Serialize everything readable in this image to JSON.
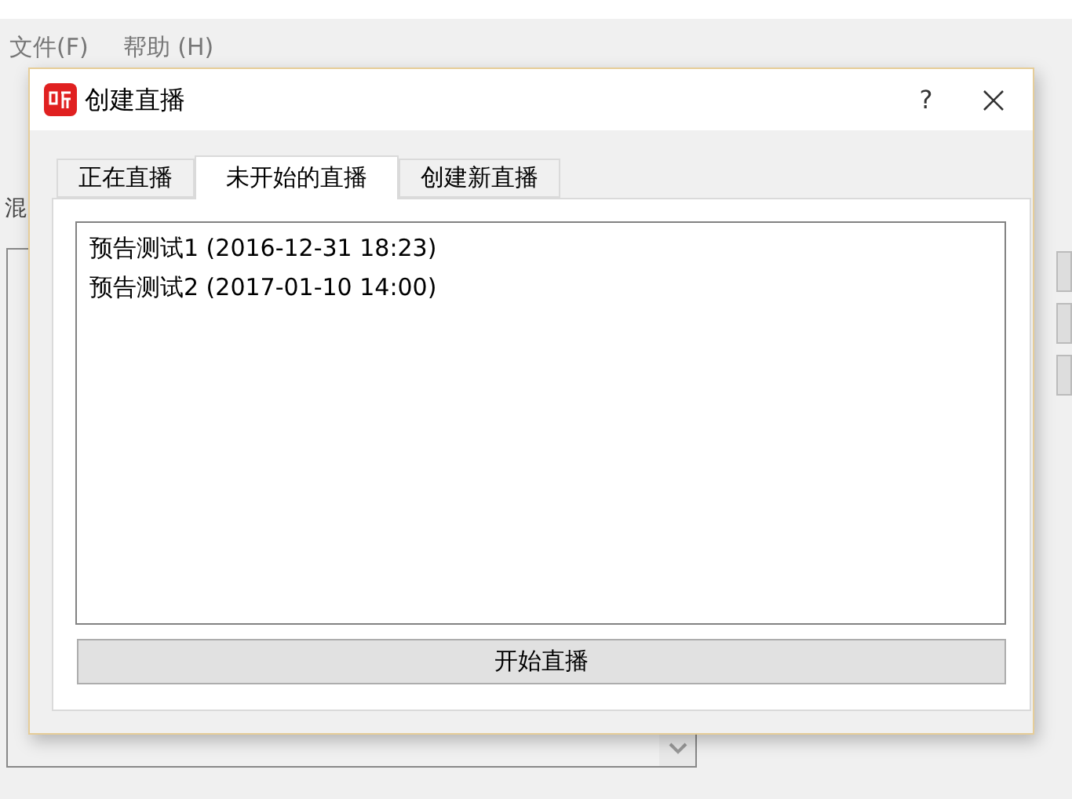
{
  "app": {
    "menu": [
      {
        "label": "文件(F)"
      },
      {
        "label": "帮助 (H)"
      }
    ],
    "panel_label": "混"
  },
  "dialog": {
    "title": "创建直播",
    "help": "?",
    "tabs": [
      {
        "label": "正在直播",
        "selected": false
      },
      {
        "label": "未开始的直播",
        "selected": true
      },
      {
        "label": "创建新直播",
        "selected": false
      }
    ],
    "list": [
      {
        "text": "预告测试1 (2016-12-31 18:23)"
      },
      {
        "text": "预告测试2 (2017-01-10 14:00)"
      }
    ],
    "button": "开始直播"
  }
}
